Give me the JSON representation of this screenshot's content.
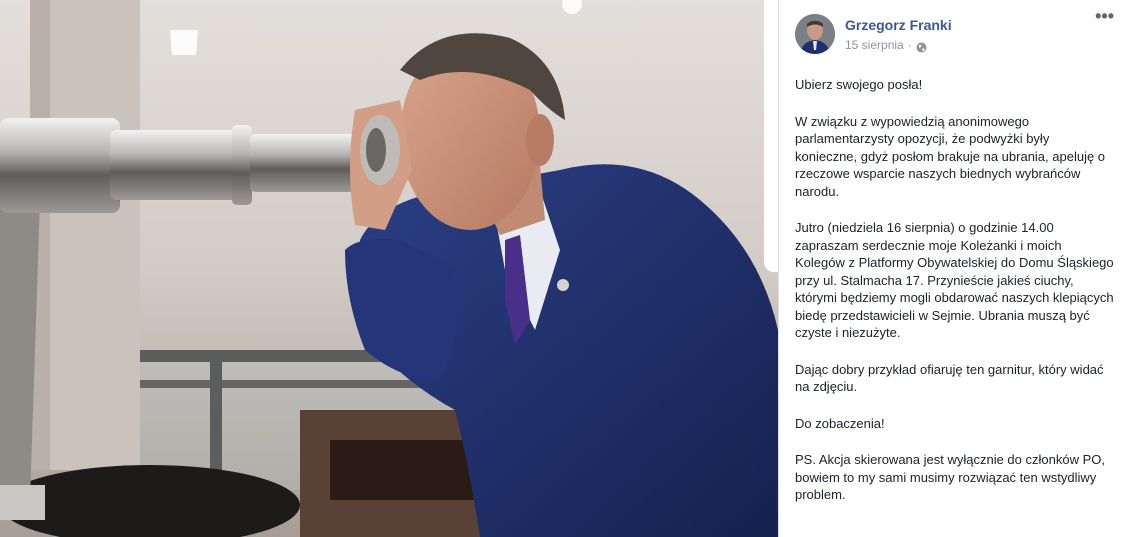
{
  "photo": {
    "alt": "photo"
  },
  "post": {
    "author": "Grzegorz Franki",
    "date": "15 sierpnia",
    "separator": "·",
    "audience_icon": "globe-icon",
    "more_icon": "more-options-icon",
    "more_label": "•••",
    "paragraphs": [
      "Ubierz swojego posła!",
      "W związku z wypowiedzią anonimowego parlamentarzysty opozycji, że podwyżki były konieczne, gdyż posłom brakuje na ubrania, apeluję o rzeczowe wsparcie naszych biednych wybrańców narodu.",
      "Jutro (niedziela 16 sierpnia) o godzinie 14.00 zapraszam serdecznie moje Koleżanki i moich Kolegów z Platformy Obywatelskiej do Domu Śląskiego przy ul. Stalmacha 17. Przynieście jakieś ciuchy, którymi będziemy mogli obdarować naszych klepiących biedę przedstawicieli w Sejmie. Ubrania muszą być czyste i niezużyte.",
      "Dając dobry przykład ofiaruję ten garnitur, który widać na zdjęciu.",
      "Do zobaczenia!",
      "PS. Akcja skierowana jest wyłącznie do członków PO, bowiem to my sami musimy rozwiązać ten wstydliwy problem."
    ]
  },
  "colors": {
    "author_link": "#385898",
    "meta_text": "#90949c",
    "body_text": "#1d2129",
    "suit": "#1f2f6b"
  }
}
